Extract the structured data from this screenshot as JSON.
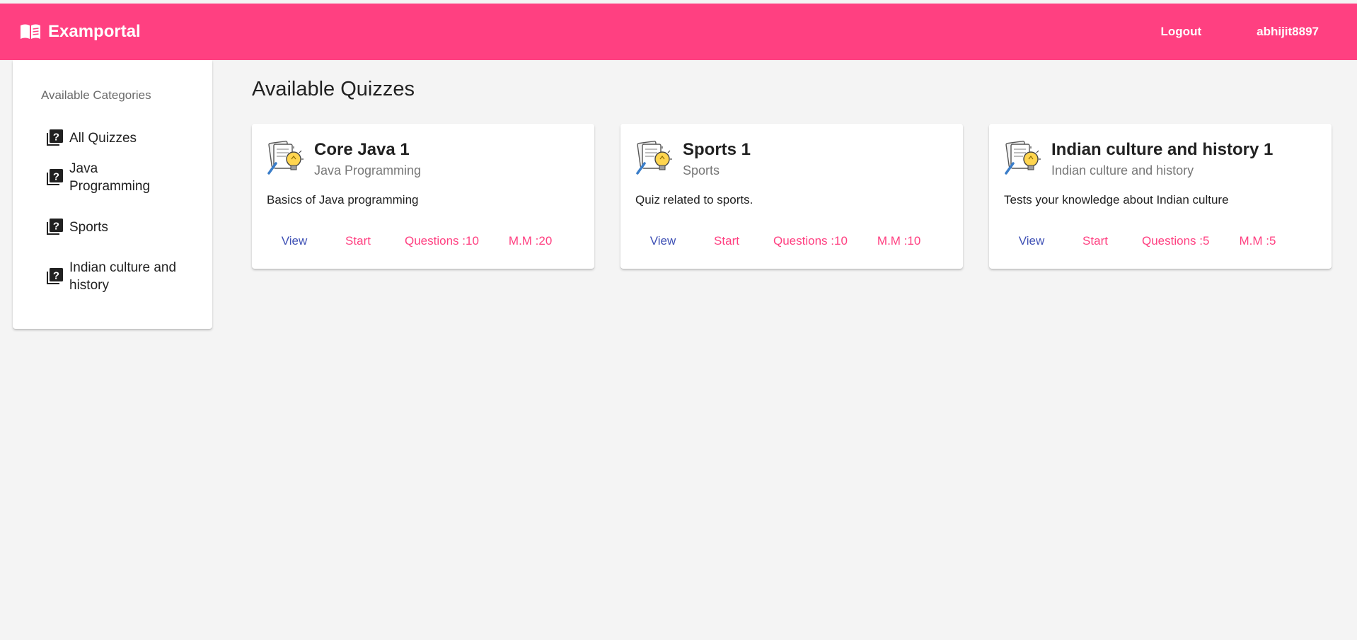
{
  "header": {
    "brand": "Examportal",
    "logout_label": "Logout",
    "username": "abhijit8897"
  },
  "sidebar": {
    "title": "Available Categories",
    "items": [
      {
        "label": "All Quizzes"
      },
      {
        "label": "Java Programming"
      },
      {
        "label": "Sports"
      },
      {
        "label": "Indian culture and history"
      }
    ]
  },
  "main": {
    "title": "Available Quizzes",
    "quizzes": [
      {
        "title": "Core Java 1",
        "category": "Java Programming",
        "description": "Basics of Java programming",
        "view_label": "View",
        "start_label": "Start",
        "questions": "Questions :10",
        "max_marks": "M.M :20"
      },
      {
        "title": "Sports 1",
        "category": "Sports",
        "description": "Quiz related to sports.",
        "view_label": "View",
        "start_label": "Start",
        "questions": "Questions :10",
        "max_marks": "M.M :10"
      },
      {
        "title": "Indian culture and history 1",
        "category": "Indian culture and history",
        "description": "Tests your knowledge about Indian culture",
        "view_label": "View",
        "start_label": "Start",
        "questions": "Questions :5",
        "max_marks": "M.M :5"
      }
    ]
  },
  "colors": {
    "accent": "#ff4081",
    "primary": "#3f51b5",
    "background": "#f4f4f4"
  },
  "icons": {
    "brand": "menu-book-icon",
    "category": "quiz-icon",
    "quiz_card": "quiz-lightbulb-icon"
  }
}
